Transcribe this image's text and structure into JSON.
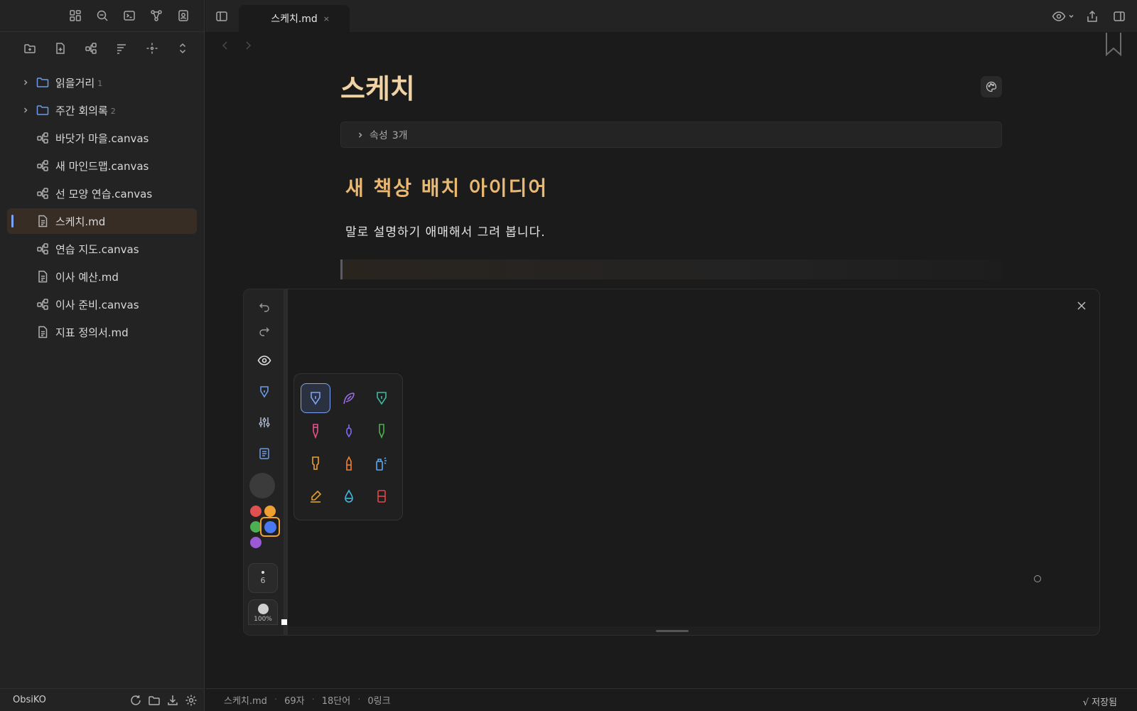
{
  "sidebar": {
    "items": [
      {
        "label": "읽을거리",
        "type": "folder",
        "count": "1"
      },
      {
        "label": "주간 회의록",
        "type": "folder",
        "count": "2"
      },
      {
        "label": "바닷가 마을.canvas",
        "type": "canvas"
      },
      {
        "label": "새 마인드맵.canvas",
        "type": "canvas"
      },
      {
        "label": "선 모양 연습.canvas",
        "type": "canvas"
      },
      {
        "label": "스케치.md",
        "type": "md"
      },
      {
        "label": "연습 지도.canvas",
        "type": "canvas"
      },
      {
        "label": "이사 예산.md",
        "type": "md"
      },
      {
        "label": "이사 준비.canvas",
        "type": "canvas"
      },
      {
        "label": "지표 정의서.md",
        "type": "md"
      }
    ],
    "vault_name": "ObsiKO"
  },
  "tab": {
    "title": "스케치.md",
    "close": "×"
  },
  "document": {
    "title": "스케치",
    "properties_label": "속성",
    "properties_count": "3개",
    "heading": "새 책상 배치 아이디어",
    "paragraph": "말로 설명하기 애매해서 그려 봅니다."
  },
  "drawing": {
    "colors": [
      "#e05050",
      "#f0a030",
      "#4caf50",
      "#4a78f0",
      "#9b59d6"
    ],
    "selected_color": "#4a78f0",
    "size": "6",
    "opacity": "100%"
  },
  "statusbar": {
    "file": "스케치.md",
    "chars": "69자",
    "words": "18단어",
    "links": "0링크",
    "saved": "√ 저장됨"
  }
}
